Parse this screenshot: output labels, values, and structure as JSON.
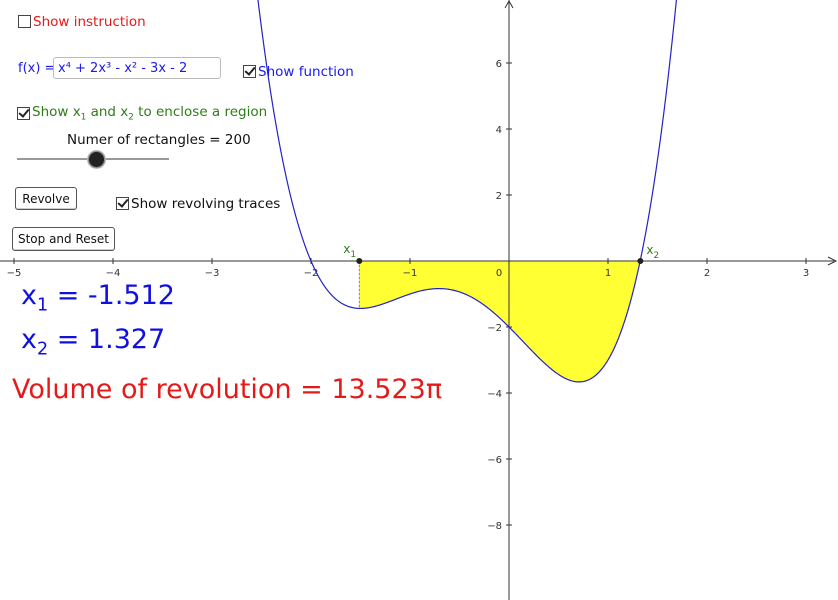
{
  "controls": {
    "show_instruction": {
      "label": "Show instruction",
      "checked": false,
      "color": "#e41a1a"
    },
    "function_label": "f(x) =",
    "function_value": "x⁴ + 2x³ - x² - 3x - 2",
    "show_function": {
      "label": "Show function",
      "checked": true,
      "color": "#1a1aee"
    },
    "show_x_region": {
      "label_pre": "Show x",
      "sub1": "1",
      "label_mid": " and x",
      "sub2": "2",
      "label_post": " to enclose a region",
      "checked": true,
      "color": "#2e7d18"
    },
    "slider": {
      "label": "Numer of rectangles = 200",
      "value": 200,
      "fraction": 0.52
    },
    "revolve_button": "Revolve",
    "show_traces": {
      "label": "Show revolving traces",
      "checked": true,
      "color": "#111111"
    },
    "stop_reset_button": "Stop and Reset"
  },
  "readouts": {
    "x1_name": "x",
    "x1_sub": "1",
    "x1_text": " = -1.512",
    "x2_name": "x",
    "x2_sub": "2",
    "x2_text": " = 1.327",
    "volume_text": "Volume of revolution = 13.523π"
  },
  "graph": {
    "x_range": [
      -5,
      3
    ],
    "y_range": [
      -10,
      7.5
    ],
    "x_ticks": [
      -5,
      -4,
      -3,
      -2,
      -1,
      0,
      1,
      2,
      3
    ],
    "y_ticks": [
      -8,
      -6,
      -4,
      -2,
      2,
      4,
      6
    ],
    "x1": -1.512,
    "x2": 1.327,
    "point_labels": {
      "x1": "x",
      "x1_sub": "1",
      "x2": "x",
      "x2_sub": "2"
    },
    "colors": {
      "curve": "#2323c8",
      "fill": "#ffff33",
      "points": "#2e7d18",
      "axis": "#333333"
    }
  }
}
